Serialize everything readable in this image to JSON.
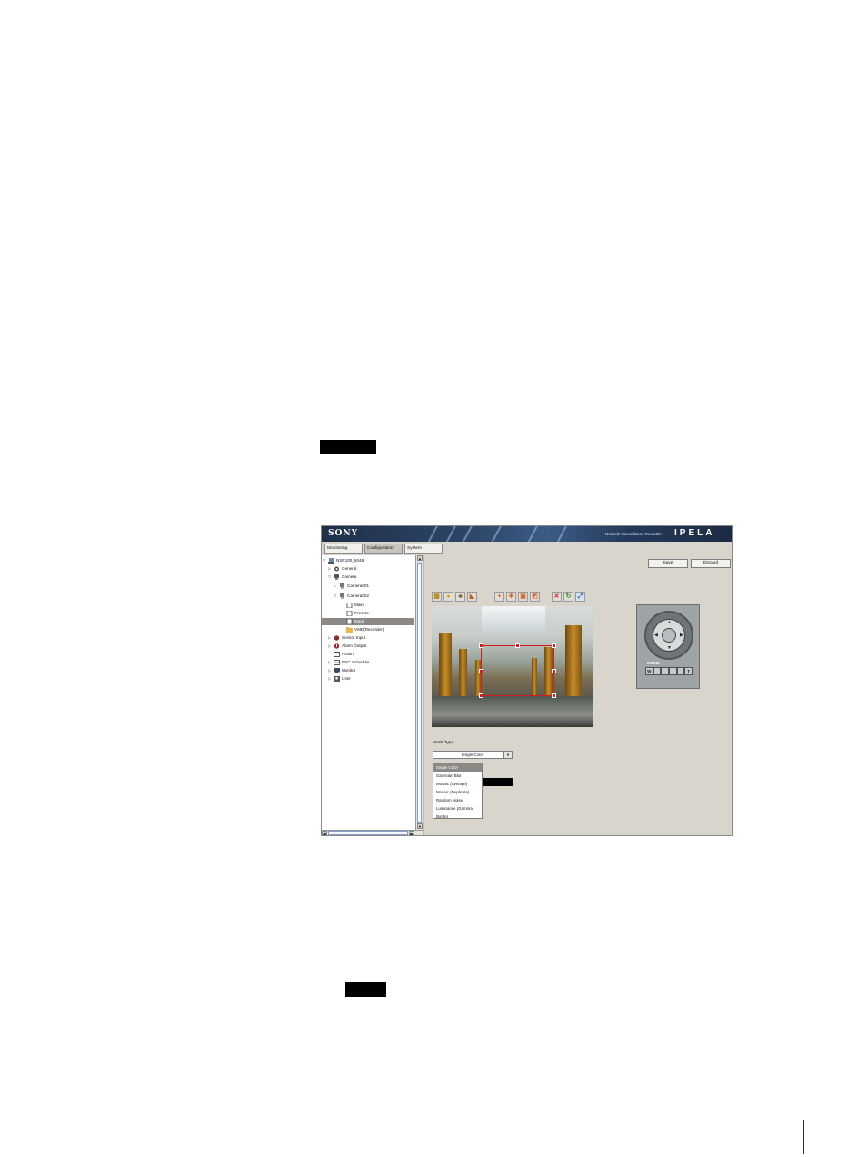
{
  "app": {
    "logo": "SONY",
    "product_name": "Network Surveillance Recorder",
    "brand": "IPELA"
  },
  "tabs": [
    {
      "label": "Monitoring"
    },
    {
      "label": "Configuration"
    },
    {
      "label": "System"
    }
  ],
  "tree": [
    {
      "label": "NSR100_5048",
      "icon": "server-icon"
    },
    {
      "label": "General",
      "icon": "gear-icon"
    },
    {
      "label": "Camera",
      "icon": "camera-icon"
    },
    {
      "label": "Camera001",
      "icon": "camera-icon"
    },
    {
      "label": "Camera002",
      "icon": "camera-icon"
    },
    {
      "label": "Main",
      "icon": "page-icon"
    },
    {
      "label": "Presets",
      "icon": "page-icon"
    },
    {
      "label": "Mask",
      "icon": "page-icon"
    },
    {
      "label": "VMD(Recorder)",
      "icon": "folder-icon"
    },
    {
      "label": "Sensor Input",
      "icon": "sensor-icon"
    },
    {
      "label": "Alarm Output",
      "icon": "alarm-icon"
    },
    {
      "label": "Action",
      "icon": "action-icon"
    },
    {
      "label": "REC Schedule",
      "icon": "schedule-icon"
    },
    {
      "label": "Monitor",
      "icon": "monitor-icon"
    },
    {
      "label": "User",
      "icon": "user-icon"
    }
  ],
  "buttons": {
    "save": "Save",
    "discard": "Discard"
  },
  "ptz": {
    "zoom_label": "ZOOM",
    "wide": "W",
    "tele": "T"
  },
  "mask": {
    "type_label": "Mask Type",
    "selected": "Single Color",
    "options": [
      "Single Color",
      "Gaussian Blur",
      "Mosaic (Average)",
      "Mosaic (Duplicate)",
      "Random Noise",
      "Luminance (Gamma)",
      "Border"
    ]
  },
  "colors": {
    "banner": "#2d4566",
    "panel": "#d9d5cd",
    "selection": "#8c8886",
    "mask_outline": "#d21c1c"
  }
}
